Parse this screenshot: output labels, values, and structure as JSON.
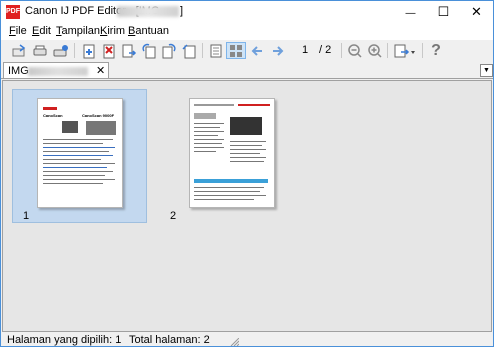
{
  "window": {
    "title": "Canon IJ PDF Editor - [IMG",
    "title_close_bracket": "]",
    "minimize_glyph": "—",
    "maximize_glyph": "☐",
    "close_glyph": "✕"
  },
  "menu": {
    "items": [
      {
        "label": "File",
        "accel": "F",
        "rest": "ile"
      },
      {
        "label": "Edit",
        "accel": "E",
        "rest": "dit"
      },
      {
        "label": "Tampilan",
        "accel": "T",
        "rest": "ampilan"
      },
      {
        "label": "Kirim",
        "accel": "K",
        "rest": "irim"
      },
      {
        "label": "Bantuan",
        "accel": "B",
        "rest": "antuan"
      }
    ]
  },
  "toolbar": {
    "icons": [
      "open-icon",
      "scan-icon",
      "scan-settings-icon",
      "add-page-icon",
      "delete-page-icon",
      "extract-page-icon",
      "rotate-left-icon",
      "rotate-right-icon",
      "page-view-icon",
      "thumbnail-view-icon",
      "previous-page-icon",
      "next-page-icon",
      "zoom-out-icon",
      "zoom-in-icon",
      "send-icon",
      "help-icon"
    ],
    "current_page": "1",
    "total_pages": "/ 2",
    "help_glyph": "?",
    "accent_color": "#4a90d9"
  },
  "tab": {
    "label": "IMG",
    "close_glyph": "✕",
    "dropdown_glyph": "▼"
  },
  "thumbnails": [
    {
      "number": "1",
      "selected": true
    },
    {
      "number": "2",
      "selected": false
    }
  ],
  "page1_text": {
    "heading_left": "CanoScan",
    "heading_right": "CanoScan 9000F"
  },
  "status": {
    "selected_pages": "Halaman yang dipilih: 1",
    "total_pages": "Total halaman: 2"
  }
}
